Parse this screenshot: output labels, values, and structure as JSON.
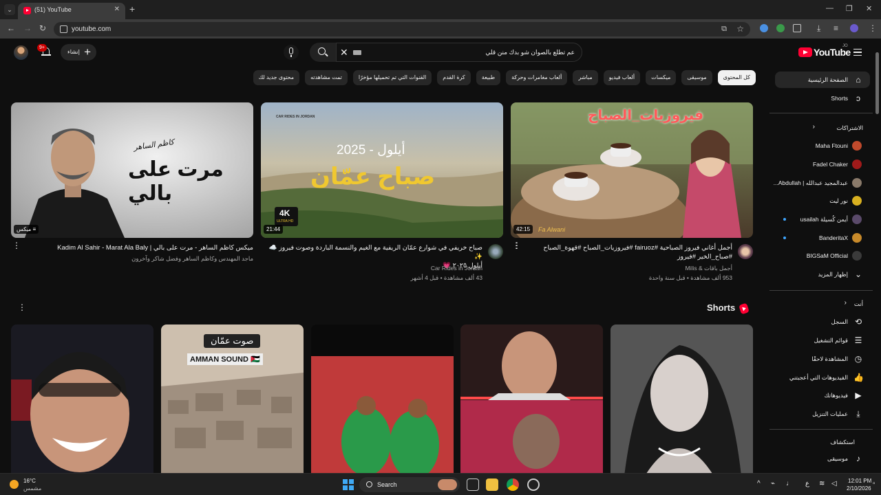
{
  "browser": {
    "tab_title": "(51) YouTube",
    "url": "youtube.com"
  },
  "masthead": {
    "create_label": "إنشاء",
    "notification_badge": "9+",
    "search_query": "عم تطلع بالصوان شو بدك منن قلي",
    "logo_text": "YouTube",
    "logo_region": "JO"
  },
  "chips": [
    "كل المحتوى",
    "موسيقى",
    "ميكسات",
    "ألعاب فيديو",
    "مباشر",
    "ألعاب مغامرات وحركة",
    "طبيعة",
    "كرة القدم",
    "القنوات التي تم تحميلها مؤخرًا",
    "تمت مشاهدته",
    "محتوى جديد لك"
  ],
  "sidebar": {
    "home": "الصفحة الرئيسية",
    "shorts": "Shorts",
    "subscriptions_header": "الاشتراكات",
    "subscriptions": [
      {
        "name": "Maha Ftouni",
        "color": "#c04a2c",
        "dot": false
      },
      {
        "name": "Fadel Chaker",
        "color": "#a01a1a",
        "dot": false
      },
      {
        "name": "عبدالمجيد عبدالله | Abdullah...",
        "color": "#8a7a6a",
        "dot": false
      },
      {
        "name": "نور ليت",
        "color": "#d8b020",
        "dot": false
      },
      {
        "name": "أيمن كُسيلة usailah",
        "color": "#5a4a6a",
        "dot": true
      },
      {
        "name": "BanderitaX",
        "color": "#c88a2a",
        "dot": true
      },
      {
        "name": "BIGSaM Official",
        "color": "#3a3a3a",
        "dot": false
      }
    ],
    "show_more": "إظهار المزيد",
    "you_header": "أنت",
    "you_items": [
      "السجل",
      "قوائم التشغيل",
      "المشاهدة لاحقًا",
      "الفيديوهات التي أعجبتني",
      "فيديوهاتك",
      "عمليات التنزيل"
    ],
    "explore_header": "استكشاف",
    "explore_items": [
      "موسيقى"
    ]
  },
  "videos": [
    {
      "title_line1": "أجمل أغاني فيروز الصباحية #fairuoz #فيروزيات_الصباح #قهوة_الصباح",
      "title_line2": "#صباح_الخير #فيروز",
      "channel": "أجمل باقات & Milis",
      "stats": "953 ألف مشاهدة • قبل سنة واحدة",
      "duration": "42:15",
      "thumb_text": "فيروزيات_الصباح",
      "watermark": "Fa Alwani"
    },
    {
      "title_line1": "صباح خريفي في شوارع عمّان الريفية مع الغيم والنسمة الباردة وصوت فيروز",
      "title_line2": "أيلول ٢٠٢٥",
      "title_emojis": "☁️ ✨",
      "title_heart": "💗",
      "channel": "Car Rides in Jordan",
      "stats": "43 ألف مشاهدة • قبل 4 أشهر",
      "duration": "21:44",
      "thumb_kicker": "CAR RIDES IN JORDAN",
      "thumb_line1": "أيلول - 2025",
      "thumb_line2": "صباح عمّان",
      "badge_top": "4K",
      "badge_bottom": "ULTRA HD"
    },
    {
      "title_line1": "ميكس كاظم الساهر - مرت على بالي | Kadim Al Sahir - Marat Ala Baly",
      "channel_line": "ماجد المهندس وكاظم الساهر وفضل شاكر وآخرون",
      "mix_label": "ميكس",
      "thumb_sig": "كاظم الساهر",
      "thumb_title": "مرت على بالي"
    }
  ],
  "shorts": {
    "header": "Shorts",
    "items": [
      {
        "overlay_top": "صوت عمّان",
        "overlay_bottom": "AMMAN SOUND 🇯🇴"
      }
    ]
  },
  "taskbar": {
    "temperature": "16°C",
    "weather": "مشمس",
    "search_label": "Search",
    "time": "12:01 PM",
    "date": "2/10/2026",
    "lang": "ع"
  }
}
